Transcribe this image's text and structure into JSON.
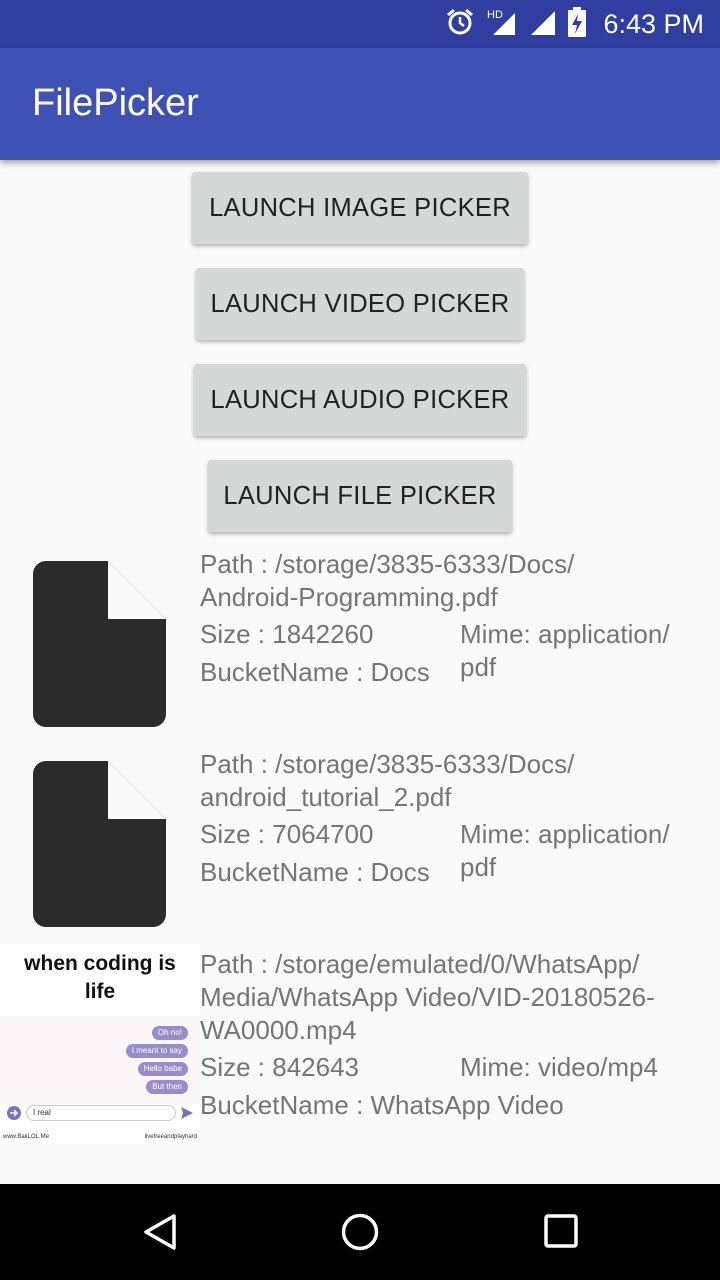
{
  "status_bar": {
    "time": "6:43 PM",
    "network_badge": "HD",
    "icons": [
      "alarm-icon",
      "signal-icon",
      "signal-icon",
      "battery-charging-icon"
    ]
  },
  "app_bar": {
    "title": "FilePicker"
  },
  "buttons": {
    "image": "LAUNCH IMAGE PICKER",
    "video": "LAUNCH VIDEO PICKER",
    "audio": "LAUNCH AUDIO PICKER",
    "file": "LAUNCH FILE PICKER"
  },
  "files": [
    {
      "thumbnail": "document-icon",
      "path_lines": [
        "Path : /storage/3835-6333/Docs/",
        "Android-Programming.pdf"
      ],
      "size": "Size : 1842260",
      "bucket": "BucketName : Docs",
      "mime_lines": [
        "Mime: application/",
        "pdf"
      ]
    },
    {
      "thumbnail": "document-icon",
      "path_lines": [
        "Path : /storage/3835-6333/Docs/",
        "android_tutorial_2.pdf"
      ],
      "size": "Size : 7064700",
      "bucket": "BucketName : Docs",
      "mime_lines": [
        "Mime: application/",
        "pdf"
      ]
    },
    {
      "thumbnail": "video-thumbnail",
      "path_lines": [
        "Path : /storage/emulated/0/WhatsApp/",
        "Media/WhatsApp Video/VID-20180526-",
        "WA0000.mp4"
      ],
      "size": "Size : 842643",
      "bucket": "BucketName : WhatsApp Video",
      "mime_lines": [
        "Mime: video/mp4"
      ]
    }
  ],
  "video_thumbnail": {
    "caption_lines": [
      "when coding is",
      "life"
    ],
    "bubbles": [
      "Oh no!",
      "I meant to say",
      "Hello babe",
      "But then"
    ],
    "input_text": "I real",
    "footer_left": "www.BakLOL.Me",
    "footer_right": "livefreeandplayhard"
  },
  "nav_bar": {
    "icons": [
      "back-icon",
      "home-icon",
      "recents-icon"
    ]
  },
  "colors": {
    "primary": "#3f51b5",
    "primary_dark": "#303f9f",
    "button": "#d6d7d7",
    "text_secondary": "#757575"
  }
}
